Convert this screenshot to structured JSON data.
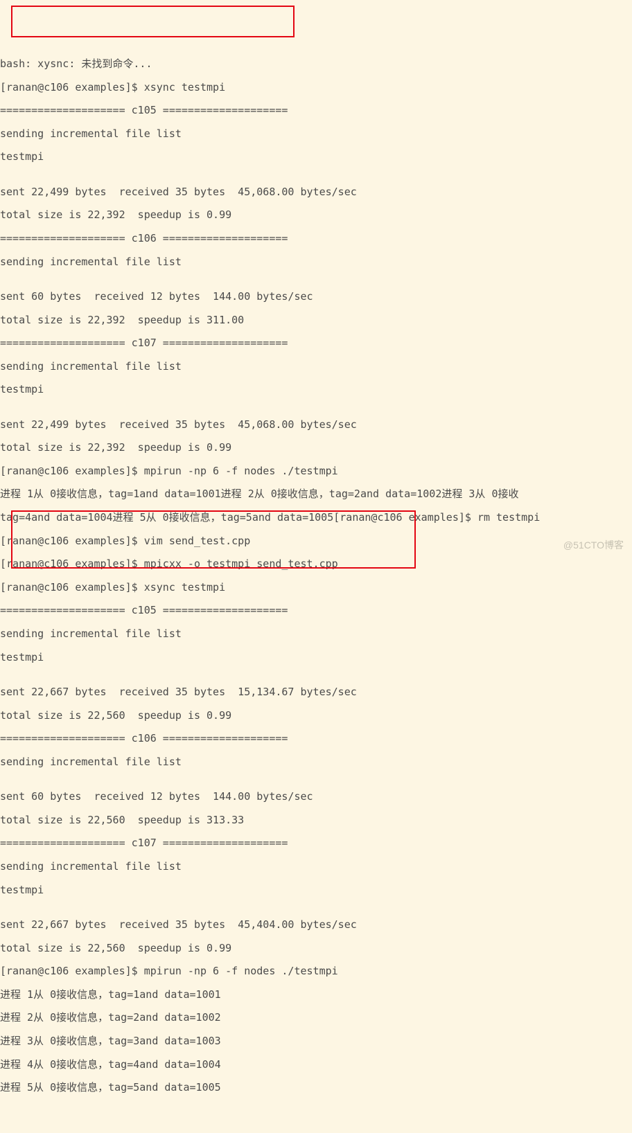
{
  "terminal": {
    "lines": [
      "bash: xysnc: 未找到命令...",
      "[ranan@c106 examples]$ xsync testmpi",
      "==================== c105 ====================",
      "sending incremental file list",
      "testmpi",
      "",
      "sent 22,499 bytes  received 35 bytes  45,068.00 bytes/sec",
      "total size is 22,392  speedup is 0.99",
      "==================== c106 ====================",
      "sending incremental file list",
      "",
      "sent 60 bytes  received 12 bytes  144.00 bytes/sec",
      "total size is 22,392  speedup is 311.00",
      "==================== c107 ====================",
      "sending incremental file list",
      "testmpi",
      "",
      "sent 22,499 bytes  received 35 bytes  45,068.00 bytes/sec",
      "total size is 22,392  speedup is 0.99",
      "[ranan@c106 examples]$ mpirun -np 6 -f nodes ./testmpi",
      "进程 1从 0接收信息，tag=1and data=1001进程 2从 0接收信息，tag=2and data=1002进程 3从 0接收",
      "tag=4and data=1004进程 5从 0接收信息，tag=5and data=1005[ranan@c106 examples]$ rm testmpi",
      "[ranan@c106 examples]$ vim send_test.cpp",
      "[ranan@c106 examples]$ mpicxx -o testmpi send_test.cpp",
      "[ranan@c106 examples]$ xsync testmpi",
      "==================== c105 ====================",
      "sending incremental file list",
      "testmpi",
      "",
      "sent 22,667 bytes  received 35 bytes  15,134.67 bytes/sec",
      "total size is 22,560  speedup is 0.99",
      "==================== c106 ====================",
      "sending incremental file list",
      "",
      "sent 60 bytes  received 12 bytes  144.00 bytes/sec",
      "total size is 22,560  speedup is 313.33",
      "==================== c107 ====================",
      "sending incremental file list",
      "testmpi",
      "",
      "sent 22,667 bytes  received 35 bytes  45,404.00 bytes/sec",
      "total size is 22,560  speedup is 0.99",
      "[ranan@c106 examples]$ mpirun -np 6 -f nodes ./testmpi",
      "进程 1从 0接收信息，tag=1and data=1001",
      "进程 2从 0接收信息，tag=2and data=1002",
      "进程 3从 0接收信息，tag=3and data=1003",
      "进程 4从 0接收信息，tag=4and data=1004",
      "进程 5从 0接收信息，tag=5and data=1005"
    ]
  },
  "watermark": "@51CTO博客"
}
